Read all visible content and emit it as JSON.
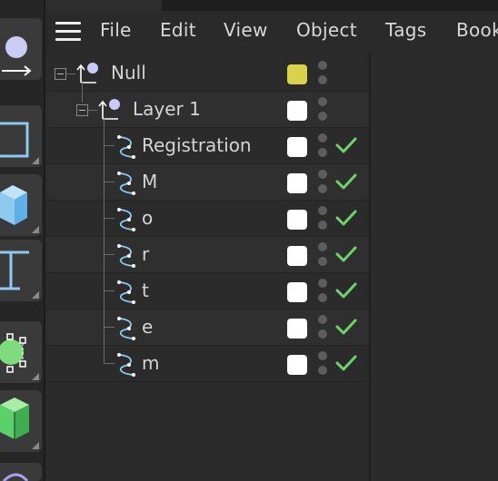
{
  "menu": {
    "items": [
      "File",
      "Edit",
      "View",
      "Object",
      "Tags",
      "Book"
    ]
  },
  "tools": [
    {
      "name": "null-object-tool",
      "icon": "null-object-icon"
    },
    {
      "name": "rectangle-spline-tool",
      "icon": "rectangle-icon"
    },
    {
      "name": "cube-tool",
      "icon": "cube-icon"
    },
    {
      "name": "text-tool",
      "icon": "text-icon"
    },
    {
      "name": "deformer-tool",
      "icon": "polygon-select-icon"
    },
    {
      "name": "generator-tool",
      "icon": "extrude-cube-icon"
    }
  ],
  "objects": [
    {
      "label": "Null",
      "type": "null",
      "depth": 0,
      "expanded": true,
      "swatch": "#dcd24a",
      "enabled": null
    },
    {
      "label": "Layer 1",
      "type": "null",
      "depth": 1,
      "expanded": true,
      "swatch": "#ffffff",
      "enabled": null
    },
    {
      "label": "Registration",
      "type": "spline",
      "depth": 2,
      "swatch": "#ffffff",
      "enabled": true
    },
    {
      "label": "M",
      "type": "spline",
      "depth": 2,
      "swatch": "#ffffff",
      "enabled": true
    },
    {
      "label": "o",
      "type": "spline",
      "depth": 2,
      "swatch": "#ffffff",
      "enabled": true
    },
    {
      "label": "r",
      "type": "spline",
      "depth": 2,
      "swatch": "#ffffff",
      "enabled": true
    },
    {
      "label": "t",
      "type": "spline",
      "depth": 2,
      "swatch": "#ffffff",
      "enabled": true
    },
    {
      "label": "e",
      "type": "spline",
      "depth": 2,
      "swatch": "#ffffff",
      "enabled": true
    },
    {
      "label": "m",
      "type": "spline",
      "depth": 2,
      "swatch": "#ffffff",
      "enabled": true
    }
  ],
  "colors": {
    "check": "#6fd36b",
    "icon_blue": "#8ec9f0",
    "null_icon": "#c7cdf7"
  }
}
